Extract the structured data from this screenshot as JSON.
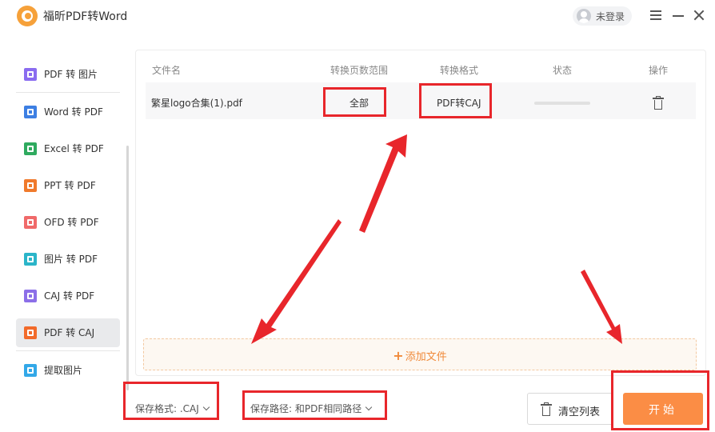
{
  "app": {
    "title": "福昕PDF转Word"
  },
  "user": {
    "label": "未登录"
  },
  "sidebar": {
    "items": [
      {
        "label": "PDF 转 图片",
        "color": "#8a6cf0"
      },
      {
        "label": "Word 转 PDF",
        "color": "#3d7fe3"
      },
      {
        "label": "Excel 转 PDF",
        "color": "#2faa5f"
      },
      {
        "label": "PPT 转 PDF",
        "color": "#f07a2c"
      },
      {
        "label": "OFD 转 PDF",
        "color": "#f06a6a"
      },
      {
        "label": "图片 转 PDF",
        "color": "#2bb5c9"
      },
      {
        "label": "CAJ 转 PDF",
        "color": "#8c6fe8"
      },
      {
        "label": "PDF 转 CAJ",
        "color": "#f26a2a",
        "active": true
      },
      {
        "label": "提取图片",
        "color": "#33a8e8"
      }
    ]
  },
  "table": {
    "headers": [
      "文件名",
      "转换页数范围",
      "转换格式",
      "状态",
      "操作"
    ],
    "rows": [
      {
        "filename": "繁星logo合集(1).pdf",
        "page_range": "全部",
        "format": "PDF转CAJ",
        "status": ""
      }
    ]
  },
  "add_file": {
    "label": "添加文件"
  },
  "bottom": {
    "save_format": "保存格式: .CAJ",
    "save_path": "保存路径: 和PDF相同路径",
    "clear_label": "清空列表",
    "start_label": "开始"
  },
  "colors": {
    "accent": "#fb8d45",
    "annotation": "#e8262b"
  }
}
